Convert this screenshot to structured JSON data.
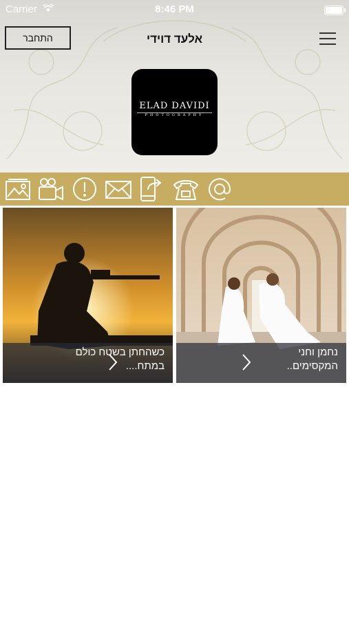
{
  "status_bar": {
    "carrier": "Carrier",
    "time": "8:46 PM"
  },
  "header": {
    "login_label": "התחבר",
    "title": "אלעד דוידי",
    "logo_main": "ELAD DAVIDI",
    "logo_sub": "PHOTOGRAPHY"
  },
  "icon_bar": {
    "color": "#c7ad62",
    "icons": [
      "gallery-icon",
      "video-camera-icon",
      "info-icon",
      "mail-icon",
      "share-phone-icon",
      "telephone-icon",
      "at-icon"
    ]
  },
  "cards": [
    {
      "caption": "נחמן וחני המקסימים.."
    },
    {
      "caption": "כשהחתן בשטח כולם במתח...."
    }
  ]
}
